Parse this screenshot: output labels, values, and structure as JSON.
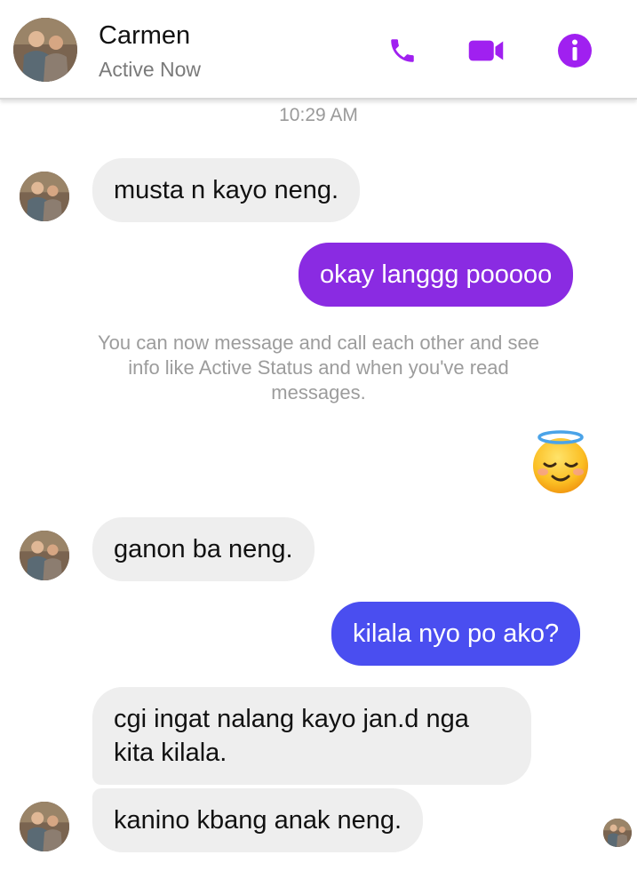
{
  "header": {
    "contact_name": "Carmen",
    "status": "Active Now",
    "actions": [
      "phone-icon",
      "video-camera-icon",
      "info-icon"
    ],
    "accent_color": "#a020f0"
  },
  "thread": {
    "timestamp": "10:29 AM",
    "messages": [
      {
        "direction": "incoming",
        "text": "musta n kayo neng."
      },
      {
        "direction": "outgoing",
        "text": "okay langgg pooooo",
        "color": "#8a2be2"
      },
      {
        "direction": "incoming",
        "text": "ganon ba neng."
      },
      {
        "direction": "outgoing",
        "text": "kilala nyo po ako?",
        "color": "#4a4ef0"
      },
      {
        "direction": "incoming",
        "text": "cgi ingat nalang kayo jan.d nga kita kilala."
      },
      {
        "direction": "incoming",
        "text": "kanino kbang anak neng."
      }
    ],
    "system_note": "You can now message and call each other and see info like Active Status and when you've read messages.",
    "reaction_emoji": "smiling-face-with-halo"
  }
}
